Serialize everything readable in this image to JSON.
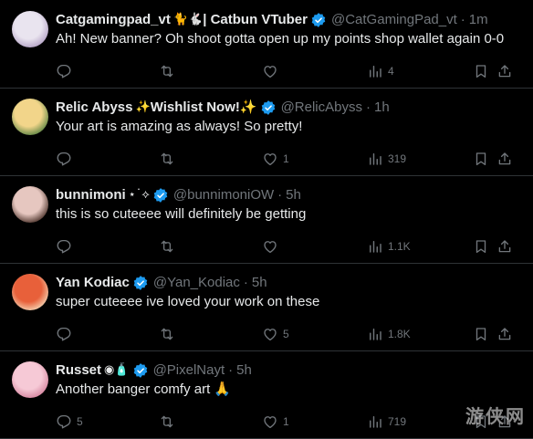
{
  "tweets": [
    {
      "name": "Catgamingpad_vt",
      "name_emojis": "🐈🐇",
      "name_suffix": " | Catbun VTuber",
      "handle": "@CatGamingPad_vt",
      "time": "1m",
      "text": "Ah! New banner? Oh shoot gotta open up my points shop wallet again 0-0",
      "replies": "",
      "retweets": "",
      "likes": "",
      "views": "4",
      "avatar_colors": [
        "#e9e4ef",
        "#b9a8c9"
      ]
    },
    {
      "name": "Relic Abyss",
      "name_emojis": "✨",
      "name_suffix": " Wishlist Now!✨",
      "handle": "@RelicAbyss",
      "time": "1h",
      "text": "Your art is amazing as always! So pretty!",
      "replies": "",
      "retweets": "",
      "likes": "1",
      "views": "319",
      "avatar_colors": [
        "#f2d58a",
        "#6b8c4a"
      ]
    },
    {
      "name": "bunnimoni",
      "name_emojis": "⋆˙⟡",
      "name_suffix": "",
      "handle": "@bunnimoniOW",
      "time": "5h",
      "text": "this is so cuteeee will definitely be getting",
      "replies": "",
      "retweets": "",
      "likes": "",
      "views": "1.1K",
      "avatar_colors": [
        "#e6c7c0",
        "#5a4038"
      ]
    },
    {
      "name": "Yan Kodiac",
      "name_emojis": "",
      "name_suffix": "",
      "handle": "@Yan_Kodiac",
      "time": "5h",
      "text": "super cuteeee ive loved your work on these",
      "replies": "",
      "retweets": "",
      "likes": "5",
      "views": "1.8K",
      "avatar_colors": [
        "#e8603a",
        "#f3c9a8"
      ]
    },
    {
      "name": "Russet",
      "name_emojis": "◉🧴",
      "name_suffix": "",
      "handle": "@PixelNayt",
      "time": "5h",
      "text": "Another banger comfy art 🙏",
      "replies": "5",
      "retweets": "",
      "likes": "1",
      "views": "719",
      "avatar_colors": [
        "#f6c9d6",
        "#d98ba4"
      ]
    }
  ],
  "icons": {
    "reply": "reply-icon",
    "retweet": "retweet-icon",
    "like": "heart-icon",
    "views": "views-icon",
    "bookmark": "bookmark-icon",
    "share": "share-icon",
    "verified": "verified-badge-icon"
  },
  "colors": {
    "verified": "#1d9bf0",
    "muted": "#71767b",
    "text": "#e7e9ea",
    "divider": "#2f3336"
  },
  "watermark": "游侠网"
}
